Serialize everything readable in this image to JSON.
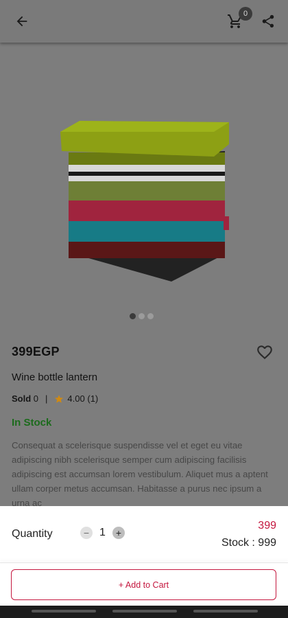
{
  "header": {
    "back_icon": "arrow-left-icon",
    "cart_icon": "cart-icon",
    "cart_count": "0",
    "share_icon": "share-icon"
  },
  "gallery": {
    "image": "product-image-stool",
    "pages": 3,
    "active_page": 1
  },
  "product": {
    "price": "399EGP",
    "name": "Wine bottle lantern",
    "sold_label": "Sold",
    "sold_count": "0",
    "separator": "|",
    "rating": "4.00",
    "rating_count": "(1)",
    "stock_status": "In Stock",
    "description": "Consequat a scelerisque suspendisse vel et eget eu vitae adipiscing nibh scelerisque semper cum adipiscing facilisis adipiscing est accumsan lorem vestibulum. Aliquet mus a aptent ullam corper metus accumsan. Habitasse a purus nec ipsum a urna ac"
  },
  "sheet": {
    "quantity_label": "Quantity",
    "quantity_value": "1",
    "minus": "−",
    "plus": "+",
    "price": "399",
    "stock": "Stock : 999",
    "add_button": "+ Add to Cart"
  },
  "colors": {
    "accent": "#c4163e",
    "in_stock": "#1c6b1c",
    "star": "#d08a12"
  }
}
